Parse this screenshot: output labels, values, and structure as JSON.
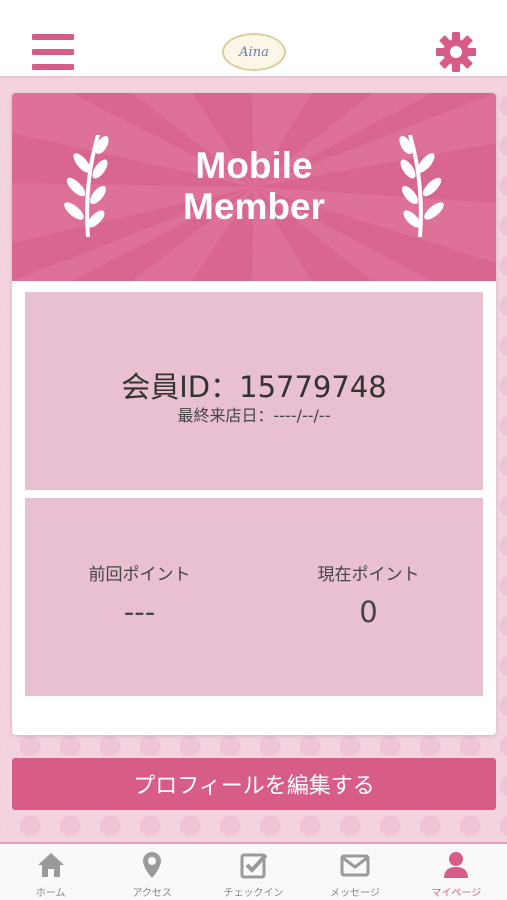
{
  "header": {
    "logo_text": "Aina",
    "menu_icon": "hamburger-menu-icon",
    "settings_icon": "gear-icon"
  },
  "colors": {
    "accent": "#d85c88",
    "banner": "#d86690",
    "panel": "#e9bfd2",
    "background": "#f4d3e1"
  },
  "banner": {
    "title": "Mobile\nMember"
  },
  "member": {
    "id_label": "会員ID：15779748",
    "last_visit_label": "最終来店日：----/--/--"
  },
  "points": {
    "previous_label": "前回ポイント",
    "previous_value": "---",
    "current_label": "現在ポイント",
    "current_value": "0"
  },
  "actions": {
    "edit_profile_label": "プロフィールを編集する"
  },
  "tabbar": {
    "items": [
      {
        "label": "ホーム",
        "icon": "home-icon"
      },
      {
        "label": "アクセス",
        "icon": "map-pin-icon"
      },
      {
        "label": "チェックイン",
        "icon": "checkin-icon"
      },
      {
        "label": "メッセージ",
        "icon": "mail-icon"
      },
      {
        "label": "マイページ",
        "icon": "user-icon",
        "active": true
      }
    ]
  }
}
